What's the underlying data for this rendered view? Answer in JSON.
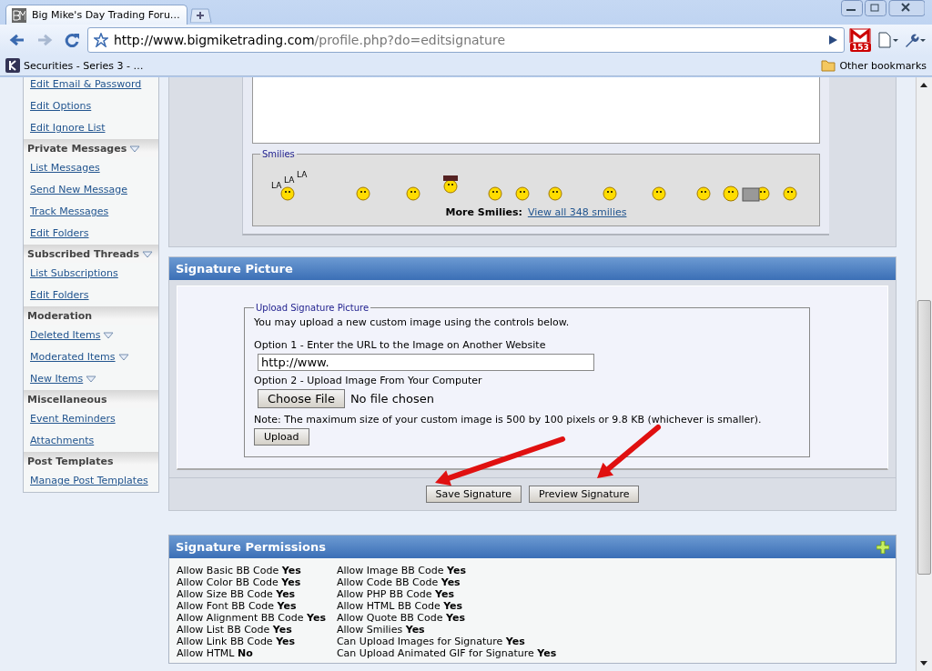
{
  "browser": {
    "tab_title": "Big Mike's Day Trading Foru…",
    "address_host": "http://www.bigmiketrading.com",
    "address_path": "/profile.php?do=editsignature",
    "mail_count": "153",
    "bookmarks": [
      "Securities - Series 3 - …"
    ],
    "other_bookmarks": "Other bookmarks"
  },
  "sidebar": {
    "groups": [
      {
        "items": [
          {
            "label": "Edit Email & Password",
            "has_menu": false
          },
          {
            "label": "Edit Options",
            "has_menu": false
          },
          {
            "label": "Edit Ignore List",
            "has_menu": false
          }
        ]
      },
      {
        "title": "Private Messages",
        "has_menu": true,
        "items": [
          {
            "label": "List Messages",
            "has_menu": false
          },
          {
            "label": "Send New Message",
            "has_menu": false
          },
          {
            "label": "Track Messages",
            "has_menu": false
          },
          {
            "label": "Edit Folders",
            "has_menu": false
          }
        ]
      },
      {
        "title": "Subscribed Threads",
        "has_menu": true,
        "items": [
          {
            "label": "List Subscriptions",
            "has_menu": false
          },
          {
            "label": "Edit Folders",
            "has_menu": false
          }
        ]
      },
      {
        "title": "Moderation",
        "has_menu": false,
        "items": [
          {
            "label": "Deleted Items",
            "has_menu": true
          },
          {
            "label": "Moderated Items",
            "has_menu": true
          },
          {
            "label": "New Items",
            "has_menu": true
          }
        ]
      },
      {
        "title": "Miscellaneous",
        "has_menu": false,
        "items": [
          {
            "label": "Event Reminders",
            "has_menu": false
          },
          {
            "label": "Attachments",
            "has_menu": false
          }
        ]
      },
      {
        "title": "Post Templates",
        "has_menu": false,
        "items": [
          {
            "label": "Manage Post Templates",
            "has_menu": false
          }
        ]
      }
    ]
  },
  "smilies": {
    "legend": "Smilies",
    "la_texts": [
      "LA",
      "LA",
      "LA"
    ],
    "more_label": "More Smilies:",
    "more_link": "View all 348 smilies"
  },
  "signature_picture": {
    "title": "Signature Picture",
    "legend": "Upload Signature Picture",
    "intro": "You may upload a new custom image using the controls below.",
    "option1": "Option 1 - Enter the URL to the Image on Another Website",
    "url_value": "http://www.",
    "option2": "Option 2 - Upload Image From Your Computer",
    "choose_button": "Choose File",
    "no_file": "No file chosen",
    "note": "Note: The maximum size of your custom image is 500 by 100 pixels or 9.8 KB (whichever is smaller).",
    "upload_button": "Upload"
  },
  "actions": [
    "Save Signature",
    "Preview Signature"
  ],
  "permissions": {
    "title": "Signature Permissions",
    "columns": [
      [
        {
          "label": "Allow Basic BB Code",
          "value": "Yes"
        },
        {
          "label": "Allow Color BB Code",
          "value": "Yes"
        },
        {
          "label": "Allow Size BB Code",
          "value": "Yes"
        },
        {
          "label": "Allow Font BB Code",
          "value": "Yes"
        },
        {
          "label": "Allow Alignment BB Code",
          "value": "Yes"
        },
        {
          "label": "Allow List BB Code",
          "value": "Yes"
        },
        {
          "label": "Allow Link BB Code",
          "value": "Yes"
        },
        {
          "label": "Allow HTML",
          "value": "No"
        }
      ],
      [
        {
          "label": "Allow Image BB Code",
          "value": "Yes"
        },
        {
          "label": "Allow Code BB Code",
          "value": "Yes"
        },
        {
          "label": "Allow PHP BB Code",
          "value": "Yes"
        },
        {
          "label": "Allow HTML BB Code",
          "value": "Yes"
        },
        {
          "label": "Allow Quote BB Code",
          "value": "Yes"
        },
        {
          "label": "Allow Smilies",
          "value": "Yes"
        },
        {
          "label": "Can Upload Images for Signature",
          "value": "Yes"
        },
        {
          "label": "Can Upload Animated GIF for Signature",
          "value": "Yes"
        }
      ]
    ]
  }
}
